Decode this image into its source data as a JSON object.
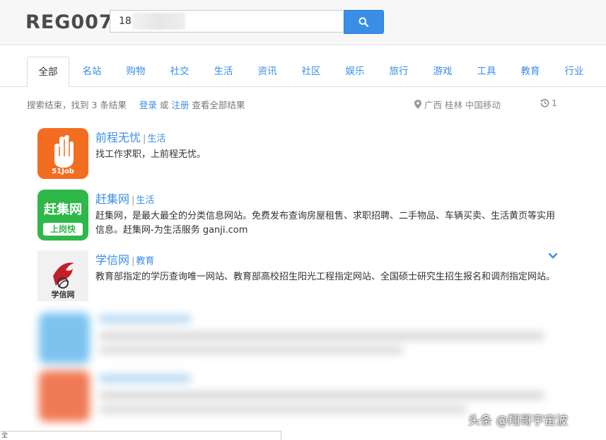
{
  "header": {
    "logo_text": "REG007",
    "search_value": "18",
    "search_button_icon": "search-icon"
  },
  "tabs": [
    {
      "label": "全部",
      "active": true
    },
    {
      "label": "名站"
    },
    {
      "label": "购物"
    },
    {
      "label": "社交"
    },
    {
      "label": "生活"
    },
    {
      "label": "资讯"
    },
    {
      "label": "社区"
    },
    {
      "label": "娱乐"
    },
    {
      "label": "旅行"
    },
    {
      "label": "游戏"
    },
    {
      "label": "工具"
    },
    {
      "label": "教育"
    },
    {
      "label": "行业"
    }
  ],
  "status": {
    "result_text": "搜索结束，找到 3 条结果",
    "login": "登录",
    "or": "或",
    "register": "注册",
    "view_all": "查看全部结果",
    "location": "广西 桂林 中国移动",
    "history_count": "1"
  },
  "results": [
    {
      "title": "前程无忧",
      "category": "生活",
      "desc": "找工作求职，上前程无忧。",
      "logo_text": "51Job",
      "logo_color": "#f36d21"
    },
    {
      "title": "赶集网",
      "category": "生活",
      "desc": "赶集网，是最大最全的分类信息网站。免费发布查询房屋租售、求职招聘、二手物品、车辆买卖、生活黄页等实用信息。赶集网-为生活服务 ganji.com",
      "logo_text_top": "赶集网",
      "logo_text_bottom": "上岗快",
      "logo_color": "#2fb84a"
    },
    {
      "title": "学信网",
      "category": "教育",
      "desc": "教育部指定的学历查询唯一网站、教育部高校招生阳光工程指定网站、全国硕士研究生招生报名和调剂指定网站。",
      "logo_text": "学信网",
      "logo_color": "#c41e2a"
    }
  ],
  "watermark": "头条 @翔哥宇宙波",
  "bottom_fragment": "全"
}
